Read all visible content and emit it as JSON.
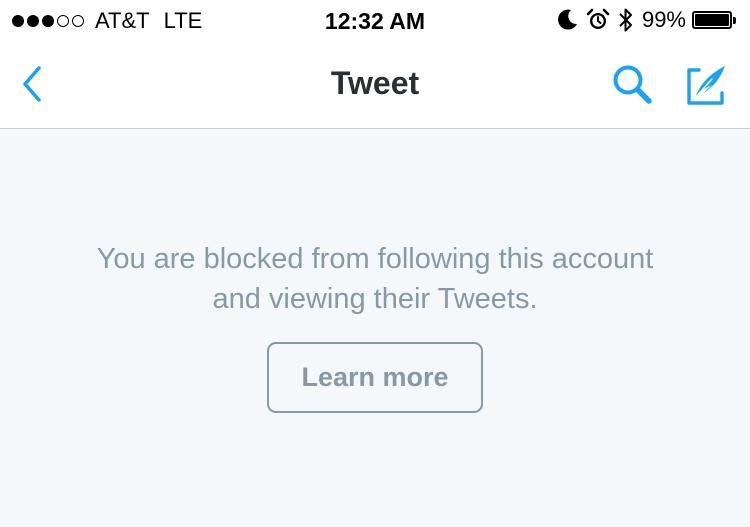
{
  "status_bar": {
    "signal_bars_filled": 3,
    "signal_bars_total": 5,
    "carrier": "AT&T",
    "network": "LTE",
    "time": "12:32 AM",
    "icons": [
      "moon-icon",
      "alarm-icon",
      "bluetooth-icon"
    ],
    "battery_percent": "99%",
    "battery_level": 0.99
  },
  "nav": {
    "title": "Tweet",
    "back_icon": "chevron-left-icon",
    "search_icon": "search-icon",
    "compose_icon": "compose-tweet-icon"
  },
  "main": {
    "blocked_message_line1": "You are blocked from following this account",
    "blocked_message_line2": "and viewing their Tweets.",
    "learn_more_label": "Learn more"
  },
  "colors": {
    "accent": "#1da1f2",
    "muted_text": "#8899a6",
    "title_text": "#292f33",
    "background": "#f5f8fa"
  }
}
